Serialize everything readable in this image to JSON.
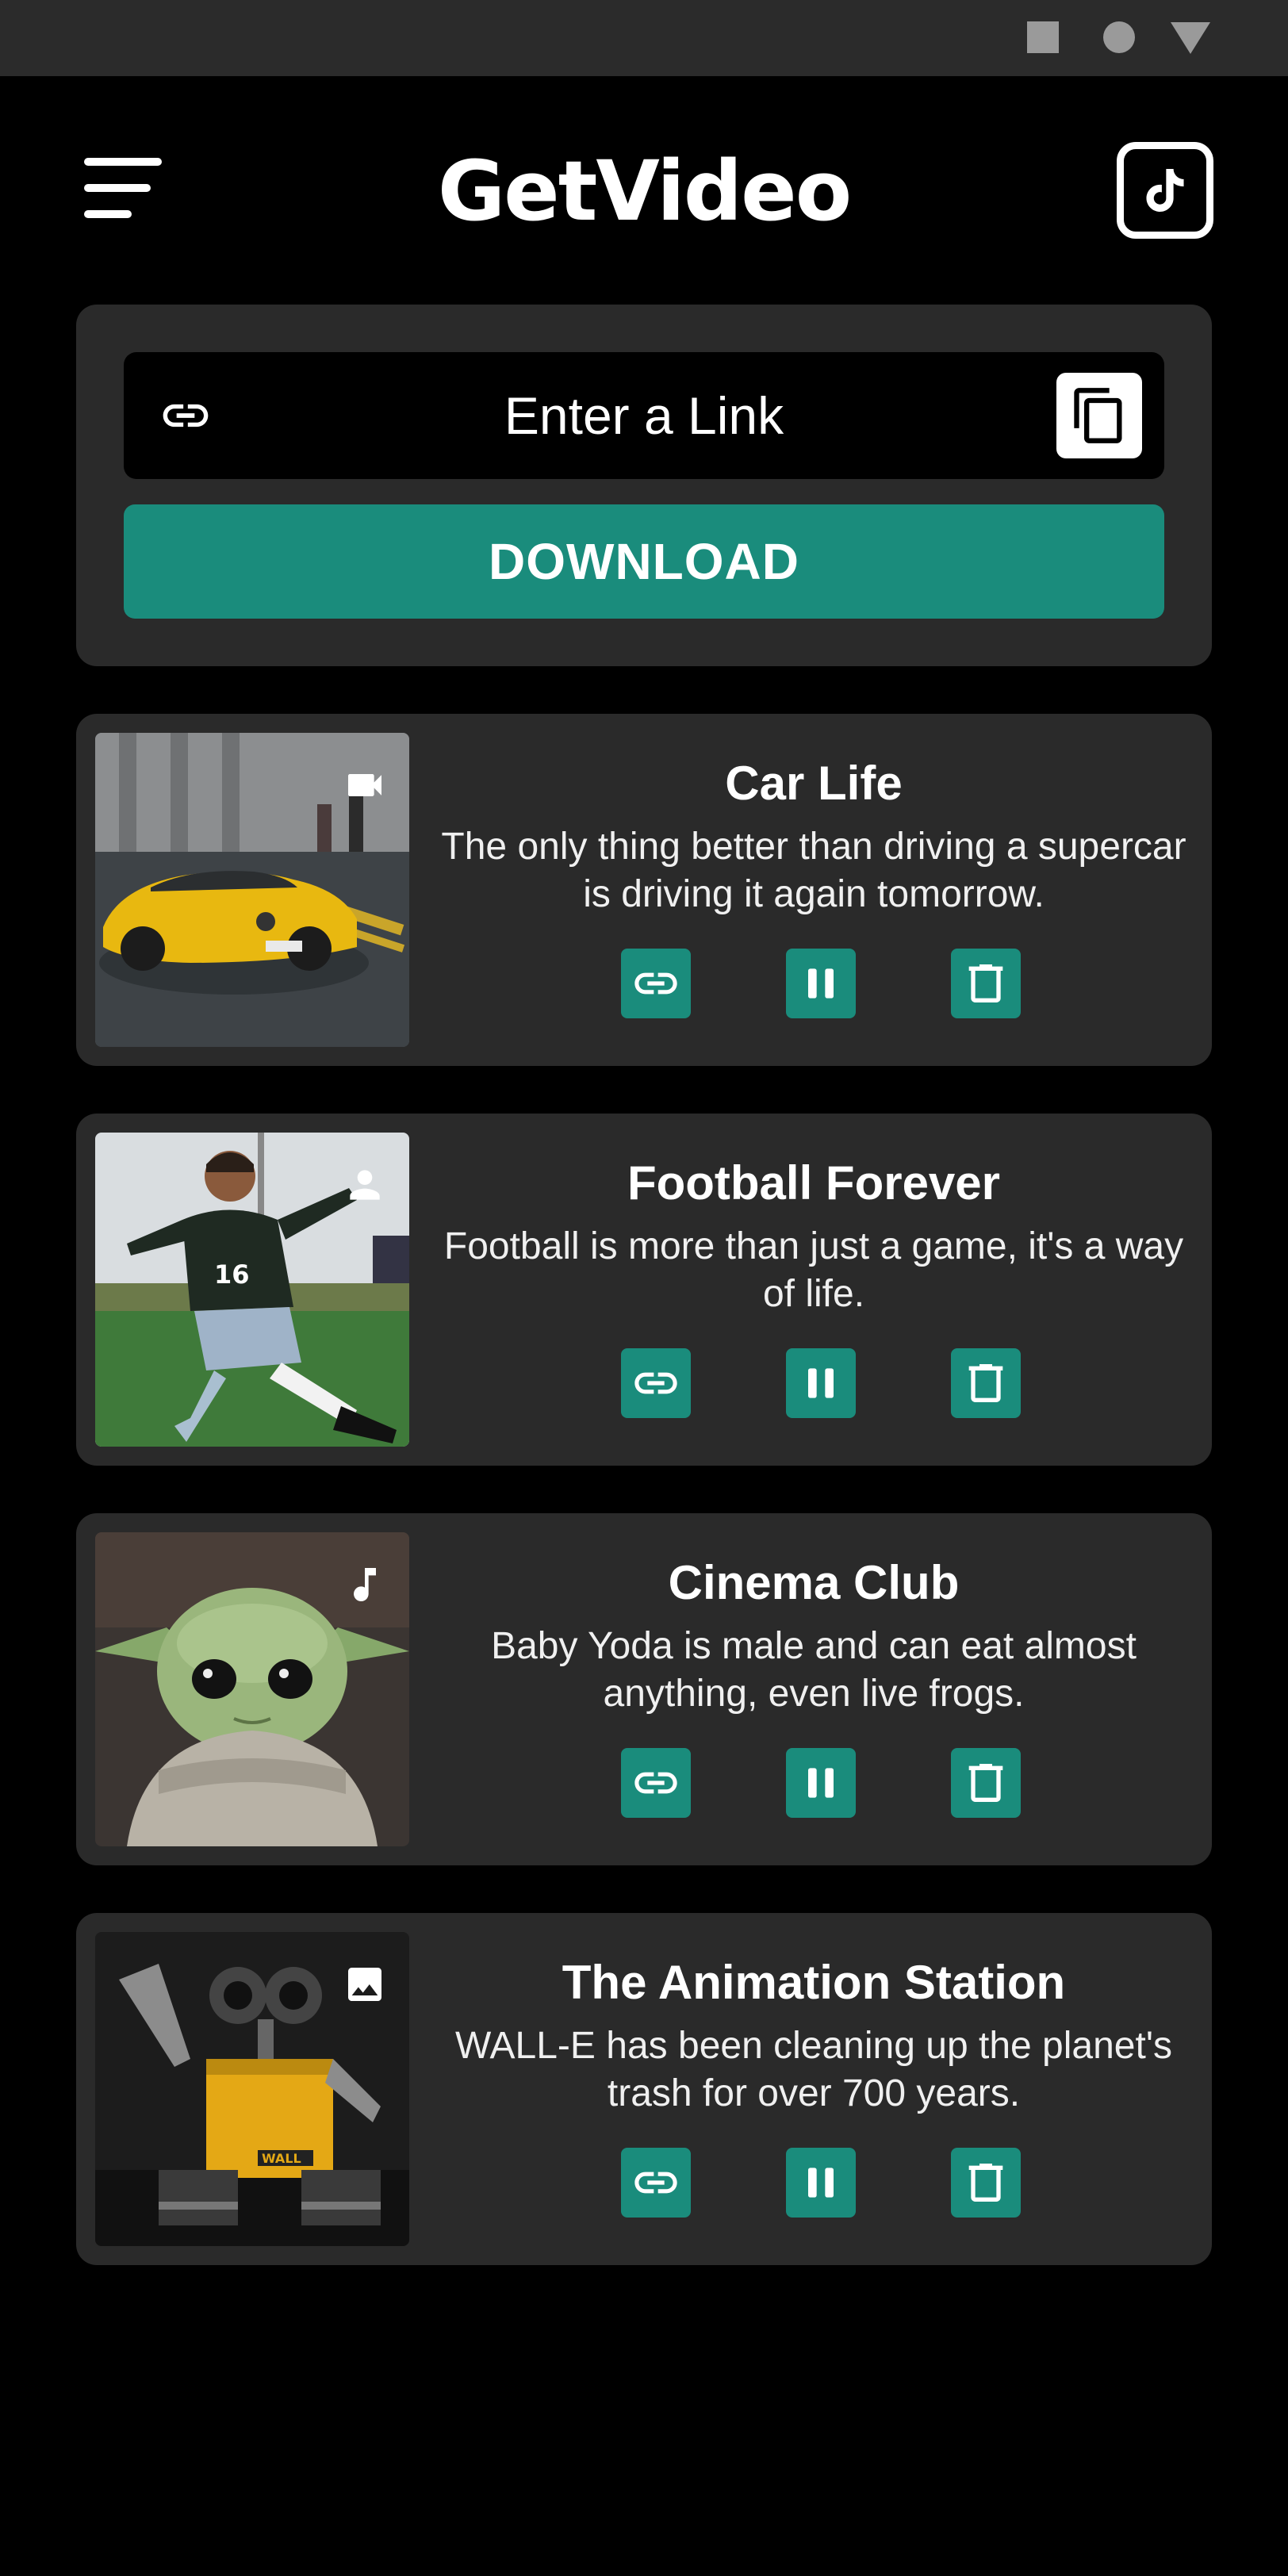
{
  "header": {
    "logo_text": "GetVideo",
    "menu_icon": "menu-icon",
    "tiktok_icon": "tiktok-icon"
  },
  "link_panel": {
    "input_placeholder": "Enter a Link",
    "input_value": "",
    "download_label": "DOWNLOAD"
  },
  "colors": {
    "accent": "#1a8c7c",
    "card_bg": "#2a2a2a",
    "page_bg": "#000000",
    "status_bar": "#2b2b2b"
  },
  "videos": [
    {
      "title": "Car Life",
      "description": "The only thing better than driving a supercar is driving it again tomorrow.",
      "type_icon": "video-camera-icon"
    },
    {
      "title": "Football Forever",
      "description": "Football is more than just a game, it's a way of life.",
      "type_icon": "person-icon"
    },
    {
      "title": "Cinema Club",
      "description": "Baby Yoda is male and can eat almost anything, even live frogs.",
      "type_icon": "music-note-icon"
    },
    {
      "title": "The Animation Station",
      "description": "WALL-E has been cleaning up the planet's trash for over 700 years.",
      "type_icon": "image-icon"
    }
  ]
}
